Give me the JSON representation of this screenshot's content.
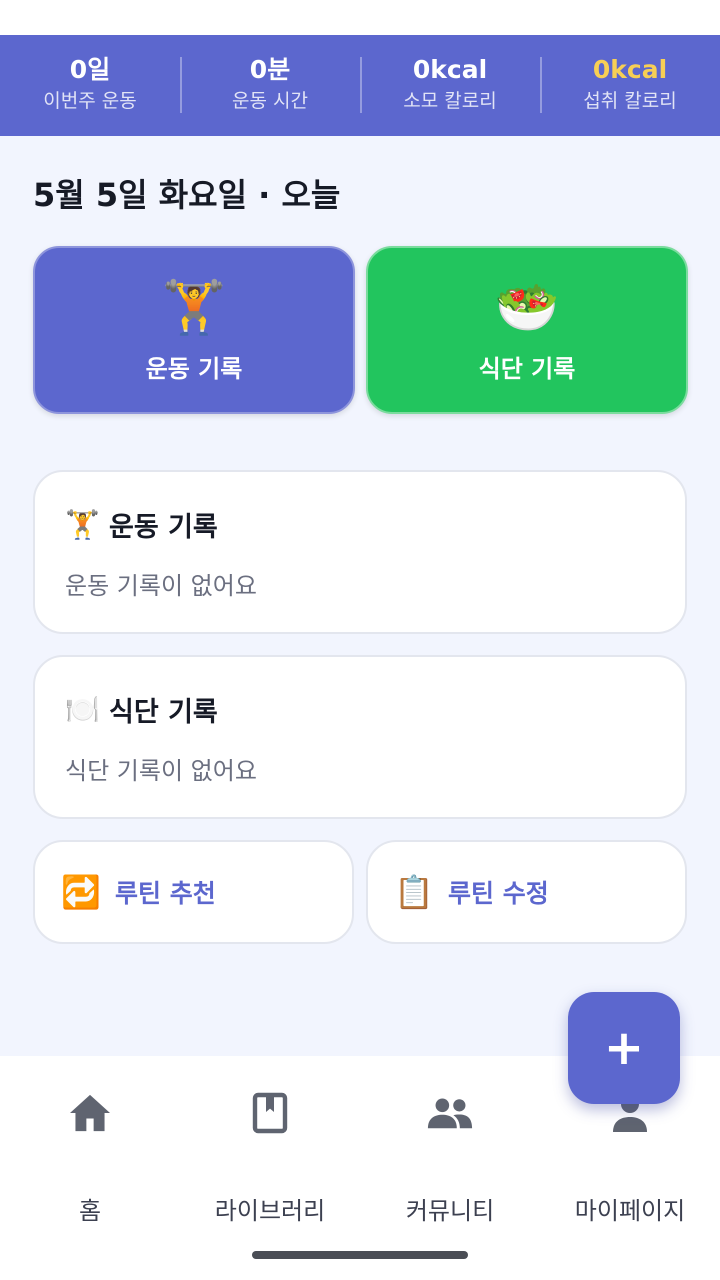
{
  "stats": [
    {
      "value": "0일",
      "label": "이번주 운동",
      "highlight": false
    },
    {
      "value": "0분",
      "label": "운동 시간",
      "highlight": false
    },
    {
      "value": "0kcal",
      "label": "소모 칼로리",
      "highlight": false
    },
    {
      "value": "0kcal",
      "label": "섭취 칼로리",
      "highlight": true
    }
  ],
  "date_heading": "5월 5일 화요일 · 오늘",
  "quick_actions": {
    "workout": {
      "emoji": "🏋️",
      "label": "운동 기록"
    },
    "diet": {
      "emoji": "🥗",
      "label": "식단 기록"
    }
  },
  "records": {
    "workout": {
      "emoji": "🏋️",
      "title": "운동 기록",
      "empty": "운동 기록이 없어요"
    },
    "diet": {
      "emoji": "🍽️",
      "title": "식단 기록",
      "empty": "식단 기록이 없어요"
    }
  },
  "routine": {
    "recommend": {
      "emoji": "🔁",
      "label": "루틴 추천"
    },
    "edit": {
      "emoji": "📋",
      "label": "루틴 수정"
    }
  },
  "fab": {
    "symbol": "+"
  },
  "nav": [
    {
      "label": "홈",
      "icon": "home-icon"
    },
    {
      "label": "라이브러리",
      "icon": "book-icon"
    },
    {
      "label": "커뮤니티",
      "icon": "people-icon"
    },
    {
      "label": "마이페이지",
      "icon": "person-icon"
    }
  ],
  "colors": {
    "primary": "#5C67CE",
    "diet_green": "#22C55E",
    "highlight_yellow": "#F7CF55",
    "background": "#F2F5FE",
    "nav_icon": "#5F6470"
  }
}
